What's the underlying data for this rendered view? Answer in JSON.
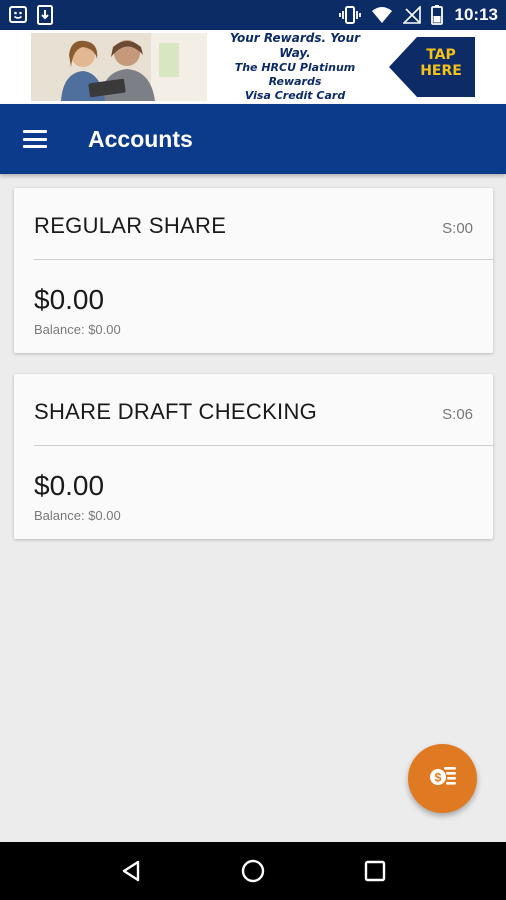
{
  "status_bar": {
    "time": "10:13",
    "left_icons": [
      "messenger-icon",
      "download-icon"
    ],
    "right_icons": [
      "vibrate-icon",
      "wifi-icon",
      "no-signal-icon",
      "battery-icon"
    ]
  },
  "banner": {
    "line1": "Your Rewards. Your Way.",
    "line2": "The HRCU Platinum Rewards",
    "line3": "Visa Credit Card",
    "tap_line1": "TAP",
    "tap_line2": "HERE",
    "colors": {
      "navy": "#0d2b66",
      "yellow": "#f4c21a"
    }
  },
  "app_bar": {
    "title": "Accounts",
    "color": "#0d3b8c"
  },
  "accounts": [
    {
      "name": "REGULAR SHARE",
      "code": "S:00",
      "amount": "$0.00",
      "balance": "Balance: $0.00"
    },
    {
      "name": "SHARE DRAFT CHECKING",
      "code": "S:06",
      "amount": "$0.00",
      "balance": "Balance: $0.00"
    }
  ],
  "fab": {
    "icon": "transfer-money-icon",
    "color": "#e07a22"
  },
  "nav_bar": {
    "icons": [
      "back-icon",
      "home-icon",
      "recents-icon"
    ]
  }
}
